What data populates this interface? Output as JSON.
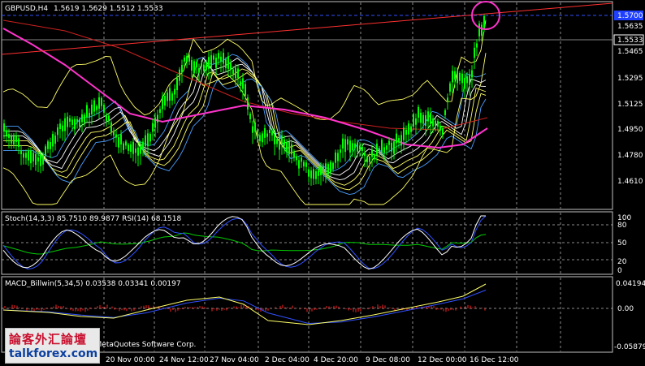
{
  "header": {
    "symbol_label": "GBPUSD,H4",
    "ohlc": "1.5619 1.5629 1.5512 1.5533"
  },
  "price_axis": {
    "ticks": [
      "1.5635",
      "1.5465",
      "1.5295",
      "1.5125",
      "1.4950",
      "1.4780",
      "1.4610"
    ],
    "current_price": "1.5533",
    "alert_price": "1.5700"
  },
  "stoch_panel": {
    "label": "Stoch(14,3,3) 85.7510 89.9877  RSI(14) 68.1518",
    "ticks": [
      "100",
      "80",
      "50",
      "20",
      "0"
    ]
  },
  "macd_panel": {
    "label": "MACD_Billwin(5,34,5) 0.03538 0.03341 0.00197",
    "ticks": [
      "0.04194",
      "0.00",
      "-0.05879"
    ]
  },
  "time_axis": {
    "labels": [
      "20 Nov 00:00",
      "24 Nov 12:00",
      "27 Nov 04:00",
      "2 Dec 04:00",
      "4 Dec 20:00",
      "9 Dec 08:00",
      "12 Dec 00:00",
      "16 Dec 12:00"
    ]
  },
  "footer": {
    "copyright": "eMetaQuotes Software Corp."
  },
  "watermark": {
    "chinese_text": "論客外汇論壇",
    "site": "talkforex.com"
  },
  "colors": {
    "background": "#000000",
    "candles": "#00ff00",
    "bollinger": "#ffff66",
    "trend_line": "#ff3030",
    "ma_magenta": "#ff33cc",
    "highlight_circle": "#ff33cc",
    "stoch_main": "#ffffff",
    "stoch_signal": "#3050ff",
    "rsi": "#00cc00",
    "macd_main": "#ffff66",
    "macd_signal": "#3050ff",
    "macd_hist": "#ff2020",
    "current_price_tag": "#000000",
    "alert_price_tag": "#2040ff"
  }
}
